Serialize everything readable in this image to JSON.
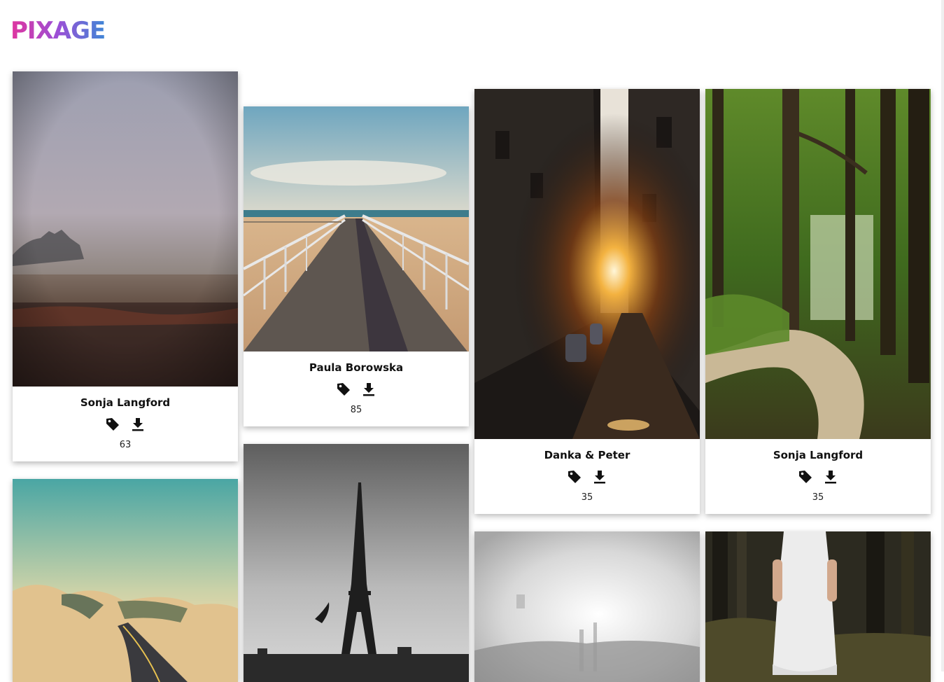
{
  "brand": {
    "name": "PIXAGE"
  },
  "cards": [
    {
      "author": "Sonja Langford",
      "likes": "63",
      "photo": "misty-field",
      "tag_icon": "tag-icon",
      "download_icon": "download-icon"
    },
    {
      "author": "Paula Borowska",
      "likes": "85",
      "photo": "boardwalk-beach",
      "tag_icon": "tag-icon",
      "download_icon": "download-icon"
    },
    {
      "author": "Danka & Peter",
      "likes": "35",
      "photo": "sunset-street",
      "tag_icon": "tag-icon",
      "download_icon": "download-icon"
    },
    {
      "author": "Sonja Langford",
      "likes": "35",
      "photo": "forest-path",
      "tag_icon": "tag-icon",
      "download_icon": "download-icon"
    },
    {
      "photo": "desert-road"
    },
    {
      "photo": "eiffel-tower"
    },
    {
      "photo": "foggy-city"
    },
    {
      "photo": "girl-in-forest"
    }
  ],
  "colors": {
    "brand_gradient": [
      "#d63aa8",
      "#8a4fd8",
      "#3b82d6"
    ],
    "background": "#ffffff"
  }
}
